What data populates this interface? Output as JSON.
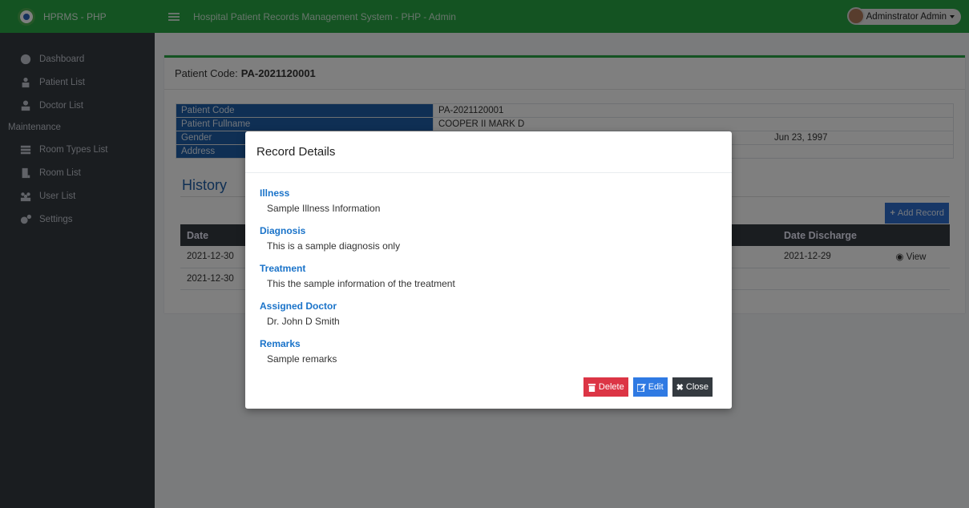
{
  "app": {
    "brand": "HPRMS - PHP",
    "title": "Hospital Patient Records Management System - PHP - Admin",
    "user": "Adminstrator Admin"
  },
  "sidebar": {
    "items": [
      {
        "label": "Dashboard",
        "icon": "dashboard-icon"
      },
      {
        "label": "Patient List",
        "icon": "patient-icon"
      },
      {
        "label": "Doctor List",
        "icon": "doctor-icon"
      }
    ],
    "section_header": "Maintenance",
    "maintenance_items": [
      {
        "label": "Room Types List",
        "icon": "table-icon"
      },
      {
        "label": "Room List",
        "icon": "room-icon"
      },
      {
        "label": "User List",
        "icon": "users-icon"
      },
      {
        "label": "Settings",
        "icon": "gears-icon"
      }
    ]
  },
  "patient": {
    "header_label": "Patient Code:",
    "header_code": "PA-2021120001",
    "rows": [
      {
        "label": "Patient Code",
        "value": "PA-2021120001"
      },
      {
        "label": "Patient Fullname",
        "value": "COOPER II MARK D"
      },
      {
        "label": "Gender",
        "value": "Jun 23, 1997"
      },
      {
        "label": "Address",
        "value": ""
      }
    ]
  },
  "history": {
    "title": "History",
    "add_label": "Add Record",
    "columns": [
      "Date",
      "Date Discharge",
      ""
    ],
    "rows": [
      {
        "date": "2021-12-30",
        "discharge": "2021-12-29",
        "action": "View"
      },
      {
        "date": "2021-12-30",
        "discharge": "",
        "action": ""
      }
    ]
  },
  "modal": {
    "title": "Record Details",
    "fields": [
      {
        "label": "Illness",
        "value": "Sample Illness Information"
      },
      {
        "label": "Diagnosis",
        "value": "This is a sample diagnosis only"
      },
      {
        "label": "Treatment",
        "value": "This the sample information of the treatment"
      },
      {
        "label": "Assigned Doctor",
        "value": "Dr. John D Smith"
      },
      {
        "label": "Remarks",
        "value": "Sample remarks"
      }
    ],
    "buttons": {
      "delete": "Delete",
      "edit": "Edit",
      "close": "Close"
    }
  },
  "colors": {
    "brand_green": "#28a745",
    "sidebar": "#343a40",
    "label_blue": "#1f5ea8",
    "delete_red": "#dc3545",
    "edit_blue": "#2f7ae3"
  }
}
